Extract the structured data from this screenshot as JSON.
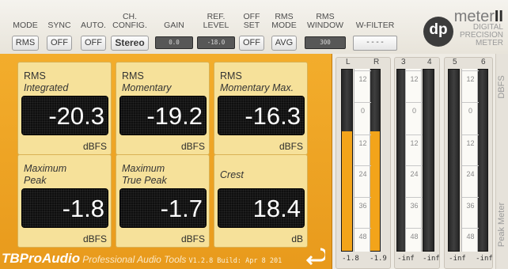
{
  "header": {
    "mode": {
      "label": "MODE",
      "value": "RMS"
    },
    "sync": {
      "label": "SYNC",
      "value": "OFF"
    },
    "auto": {
      "label": "AUTO.",
      "value": "OFF"
    },
    "ch_config": {
      "label": "CH.\nCONFIG.",
      "value": "Stereo"
    },
    "gain": {
      "label": "GAIN",
      "value": "0.0"
    },
    "ref_level": {
      "label": "REF.\nLEVEL",
      "value": "-18.0"
    },
    "offset": {
      "label": "OFF\nSET",
      "value": "OFF"
    },
    "rms_mode": {
      "label": "RMS\nMODE",
      "value": "AVG"
    },
    "rms_window": {
      "label": "RMS\nWINDOW",
      "value": "300"
    },
    "w_filter": {
      "label": "W-FILTER",
      "value": "----"
    }
  },
  "brand": {
    "logo": "dp",
    "name_light": "meter",
    "name_bold": "II",
    "sub": "DIGITAL\nPRECISION\nMETER"
  },
  "cards": [
    {
      "title1": "RMS",
      "title2": "Integrated",
      "value": "-20.3",
      "unit": "dBFS"
    },
    {
      "title1": "RMS",
      "title2": "Momentary",
      "value": "-19.2",
      "unit": "dBFS"
    },
    {
      "title1": "RMS",
      "title2": "Momentary Max.",
      "value": "-16.3",
      "unit": "dBFS"
    },
    {
      "title1": "Maximum",
      "title2": "Peak",
      "value": "-1.8",
      "unit": "dBFS"
    },
    {
      "title1": "Maximum",
      "title2": "True Peak",
      "value": "-1.7",
      "unit": "dBFS"
    },
    {
      "title1": "",
      "title2": "Crest",
      "value": "18.4",
      "unit": "dB"
    }
  ],
  "footer": {
    "brand": "TBProAudio",
    "tagline": "Professional Audio Tools",
    "version": "V1.2.8 Build: Apr  8 201"
  },
  "meters": {
    "channels": [
      {
        "label": "L",
        "level": 0.66,
        "reading": "-1.8"
      },
      {
        "label": "R",
        "level": 0.66,
        "reading": "-1.9"
      },
      {
        "label": "3",
        "level": 0,
        "reading": "-inf"
      },
      {
        "label": "4",
        "level": 0,
        "reading": "-inf"
      },
      {
        "label": "5",
        "level": 0,
        "reading": "-inf"
      },
      {
        "label": "6",
        "level": 0,
        "reading": "-inf"
      }
    ],
    "scale": [
      "12",
      "0",
      "12",
      "24",
      "36",
      "48"
    ]
  },
  "side": {
    "top_label": "DBFS",
    "bottom_label": "Peak Meter"
  },
  "colors": {
    "accent": "#f0a526",
    "card": "#f6e19a",
    "display": "#0f0f0f",
    "meter_fill": "#f3a41a"
  }
}
